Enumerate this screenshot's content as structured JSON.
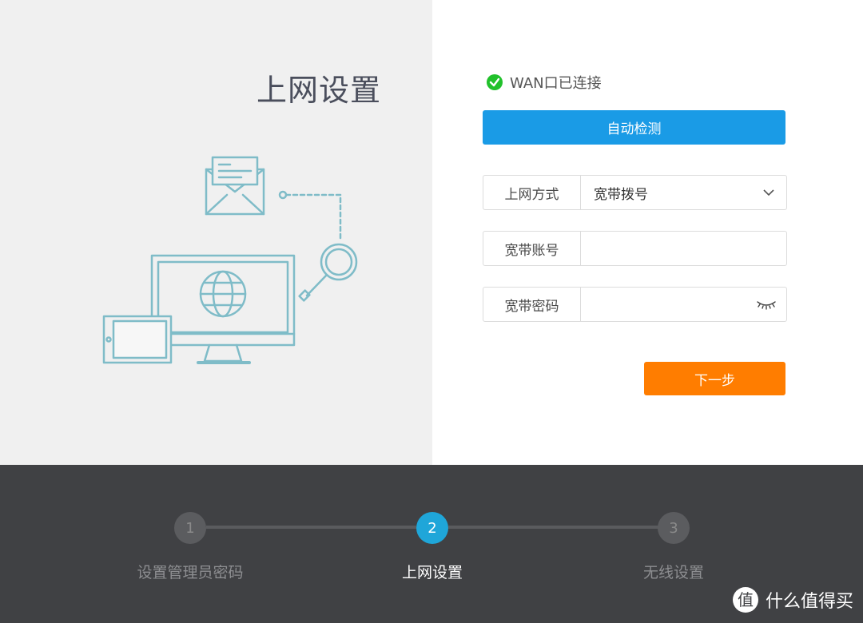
{
  "page": {
    "title": "上网设置"
  },
  "status": {
    "wan_text": "WAN口已连接",
    "icon": "check-circle-icon",
    "color": "#21c12b"
  },
  "buttons": {
    "detect_label": "自动检测",
    "next_label": "下一步"
  },
  "form": {
    "mode": {
      "label": "上网方式",
      "value": "宽带拨号",
      "icon": "chevron-down-icon"
    },
    "account": {
      "label": "宽带账号",
      "value": ""
    },
    "password": {
      "label": "宽带密码",
      "value": "",
      "icon": "eye-closed-icon"
    }
  },
  "steps": [
    {
      "number": "1",
      "label": "设置管理员密码",
      "active": false
    },
    {
      "number": "2",
      "label": "上网设置",
      "active": true
    },
    {
      "number": "3",
      "label": "无线设置",
      "active": false
    }
  ],
  "watermark": {
    "text": "什么值得买",
    "icon": "zhi-logo-icon"
  },
  "colors": {
    "primary": "#1a9be6",
    "accent": "#ff7d00",
    "step_active": "#1fa6d9",
    "footer_bg": "#404144",
    "illustration": "#7fbcc8"
  }
}
